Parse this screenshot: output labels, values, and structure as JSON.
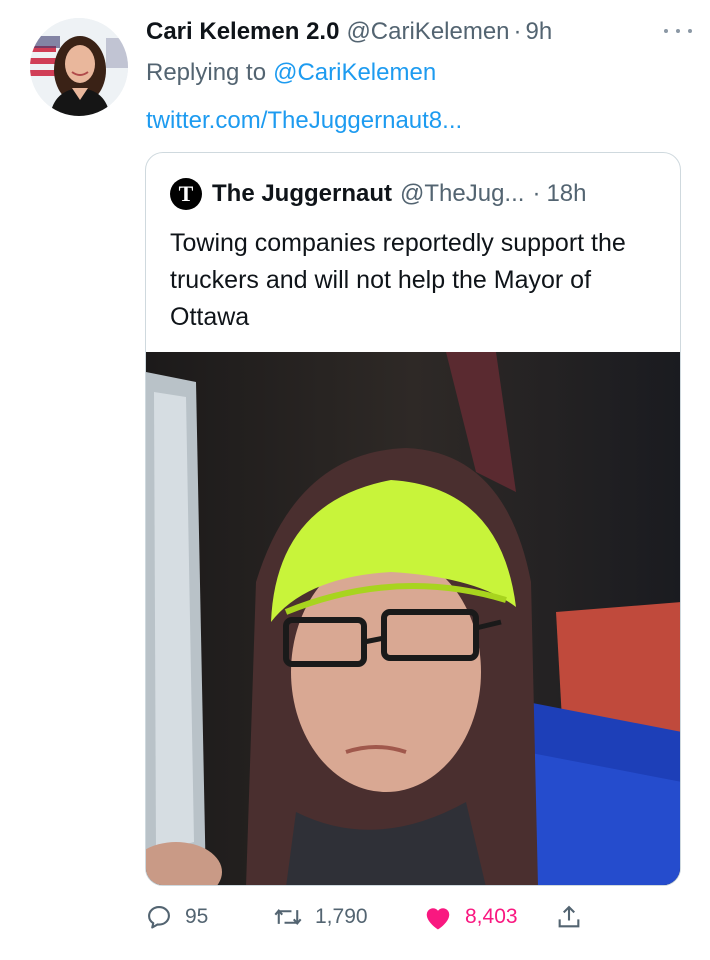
{
  "tweet": {
    "display_name": "Cari Kelemen 2.0",
    "handle": "@CariKelemen",
    "separator": "·",
    "time": "9h",
    "replying_to_label": "Replying to",
    "replying_to_handle": "@CariKelemen",
    "link_text": "twitter.com/TheJuggernaut8...",
    "avatar_icon": "profile-photo-icon",
    "more_icon": "more-dots-icon"
  },
  "quoted": {
    "avatar_letter": "T",
    "display_name": "The Juggernaut",
    "handle": "@TheJug...",
    "separator": "·",
    "time": "18h",
    "text": "Towing companies reportedly support the truckers and will not help the Mayor of Ottawa",
    "media_icon": "video-thumbnail-icon"
  },
  "actions": {
    "reply_count": "95",
    "retweet_count": "1,790",
    "like_count": "8,403",
    "reply_icon": "reply-icon",
    "retweet_icon": "retweet-icon",
    "like_icon": "heart-icon",
    "share_icon": "share-icon"
  },
  "colors": {
    "link": "#1d9bf0",
    "secondary_text": "#536471",
    "like": "#f91880",
    "primary_text": "#0f1419"
  }
}
